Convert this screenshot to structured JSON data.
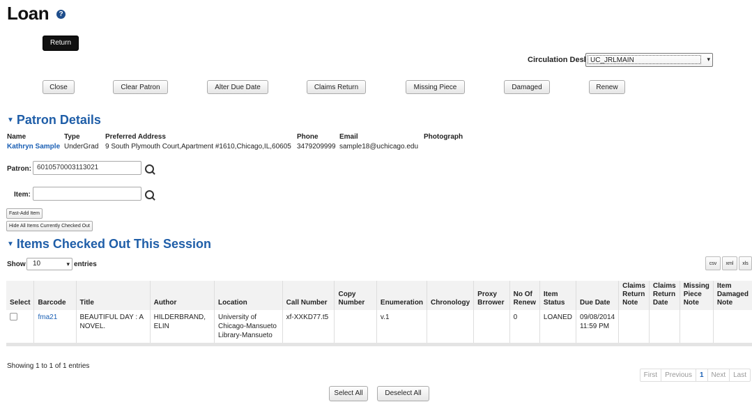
{
  "page": {
    "title": "Loan",
    "help_icon": "?"
  },
  "top": {
    "return_label": "Return"
  },
  "desk": {
    "label": "Circulation Desk:",
    "value": "UC_JRLMAIN"
  },
  "actions": {
    "close": "Close",
    "clear_patron": "Clear Patron",
    "alter_due_date": "Alter Due Date",
    "claims_return": "Claims Return",
    "missing_piece": "Missing Piece",
    "damaged": "Damaged",
    "renew": "Renew"
  },
  "patron_section": {
    "title": "Patron Details",
    "headers": {
      "name": "Name",
      "type": "Type",
      "address": "Preferred Address",
      "phone": "Phone",
      "email": "Email",
      "photo": "Photograph"
    },
    "values": {
      "name": "Kathryn Sample",
      "type": "UnderGrad",
      "address": "9 South Plymouth Court,Apartment #1610,Chicago,IL,60605",
      "phone": "3479209999",
      "email": "sample18@uchicago.edu"
    }
  },
  "form": {
    "patron_label": "Patron:",
    "patron_value": "6010570003113021",
    "item_label": "Item:",
    "item_value": "",
    "fast_add": "Fast-Add Item",
    "hide_all": "Hide All Items Currently Checked Out"
  },
  "items_section": {
    "title": "Items Checked Out This Session",
    "show": "Show",
    "entries_value": "10",
    "entries": "entries",
    "export": {
      "csv": "csv",
      "xml": "xml",
      "xls": "xls"
    },
    "columns": [
      "Select",
      "Barcode",
      "Title",
      "Author",
      "Location",
      "Call Number",
      "Copy Number",
      "Enumeration",
      "Chronology",
      "Proxy Brrower",
      "No Of Renew",
      "Item Status",
      "Due Date",
      "Claims Return Note",
      "Claims Return Date",
      "Missing Piece Note",
      "Item Damaged Note"
    ],
    "rows": [
      {
        "barcode": "fma21",
        "title": "BEAUTIFUL DAY : A NOVEL.",
        "author": "HILDERBRAND, ELIN",
        "location": "University of Chicago-Mansueto Library-Mansueto",
        "call_number": "xf-XXKD77.t5",
        "copy_number": "",
        "enumeration": "v.1",
        "chronology": "",
        "proxy": "",
        "renew": "0",
        "status": "LOANED",
        "due_date": "09/08/2014 11:59 PM",
        "claims_note": "",
        "claims_date": "",
        "missing_note": "",
        "damaged_note": ""
      }
    ],
    "showing": "Showing 1 to 1 of 1 entries",
    "pager": {
      "first": "First",
      "previous": "Previous",
      "current": "1",
      "next": "Next",
      "last": "Last"
    }
  },
  "bottom": {
    "select_all": "Select All",
    "deselect_all": "Deselect All"
  }
}
